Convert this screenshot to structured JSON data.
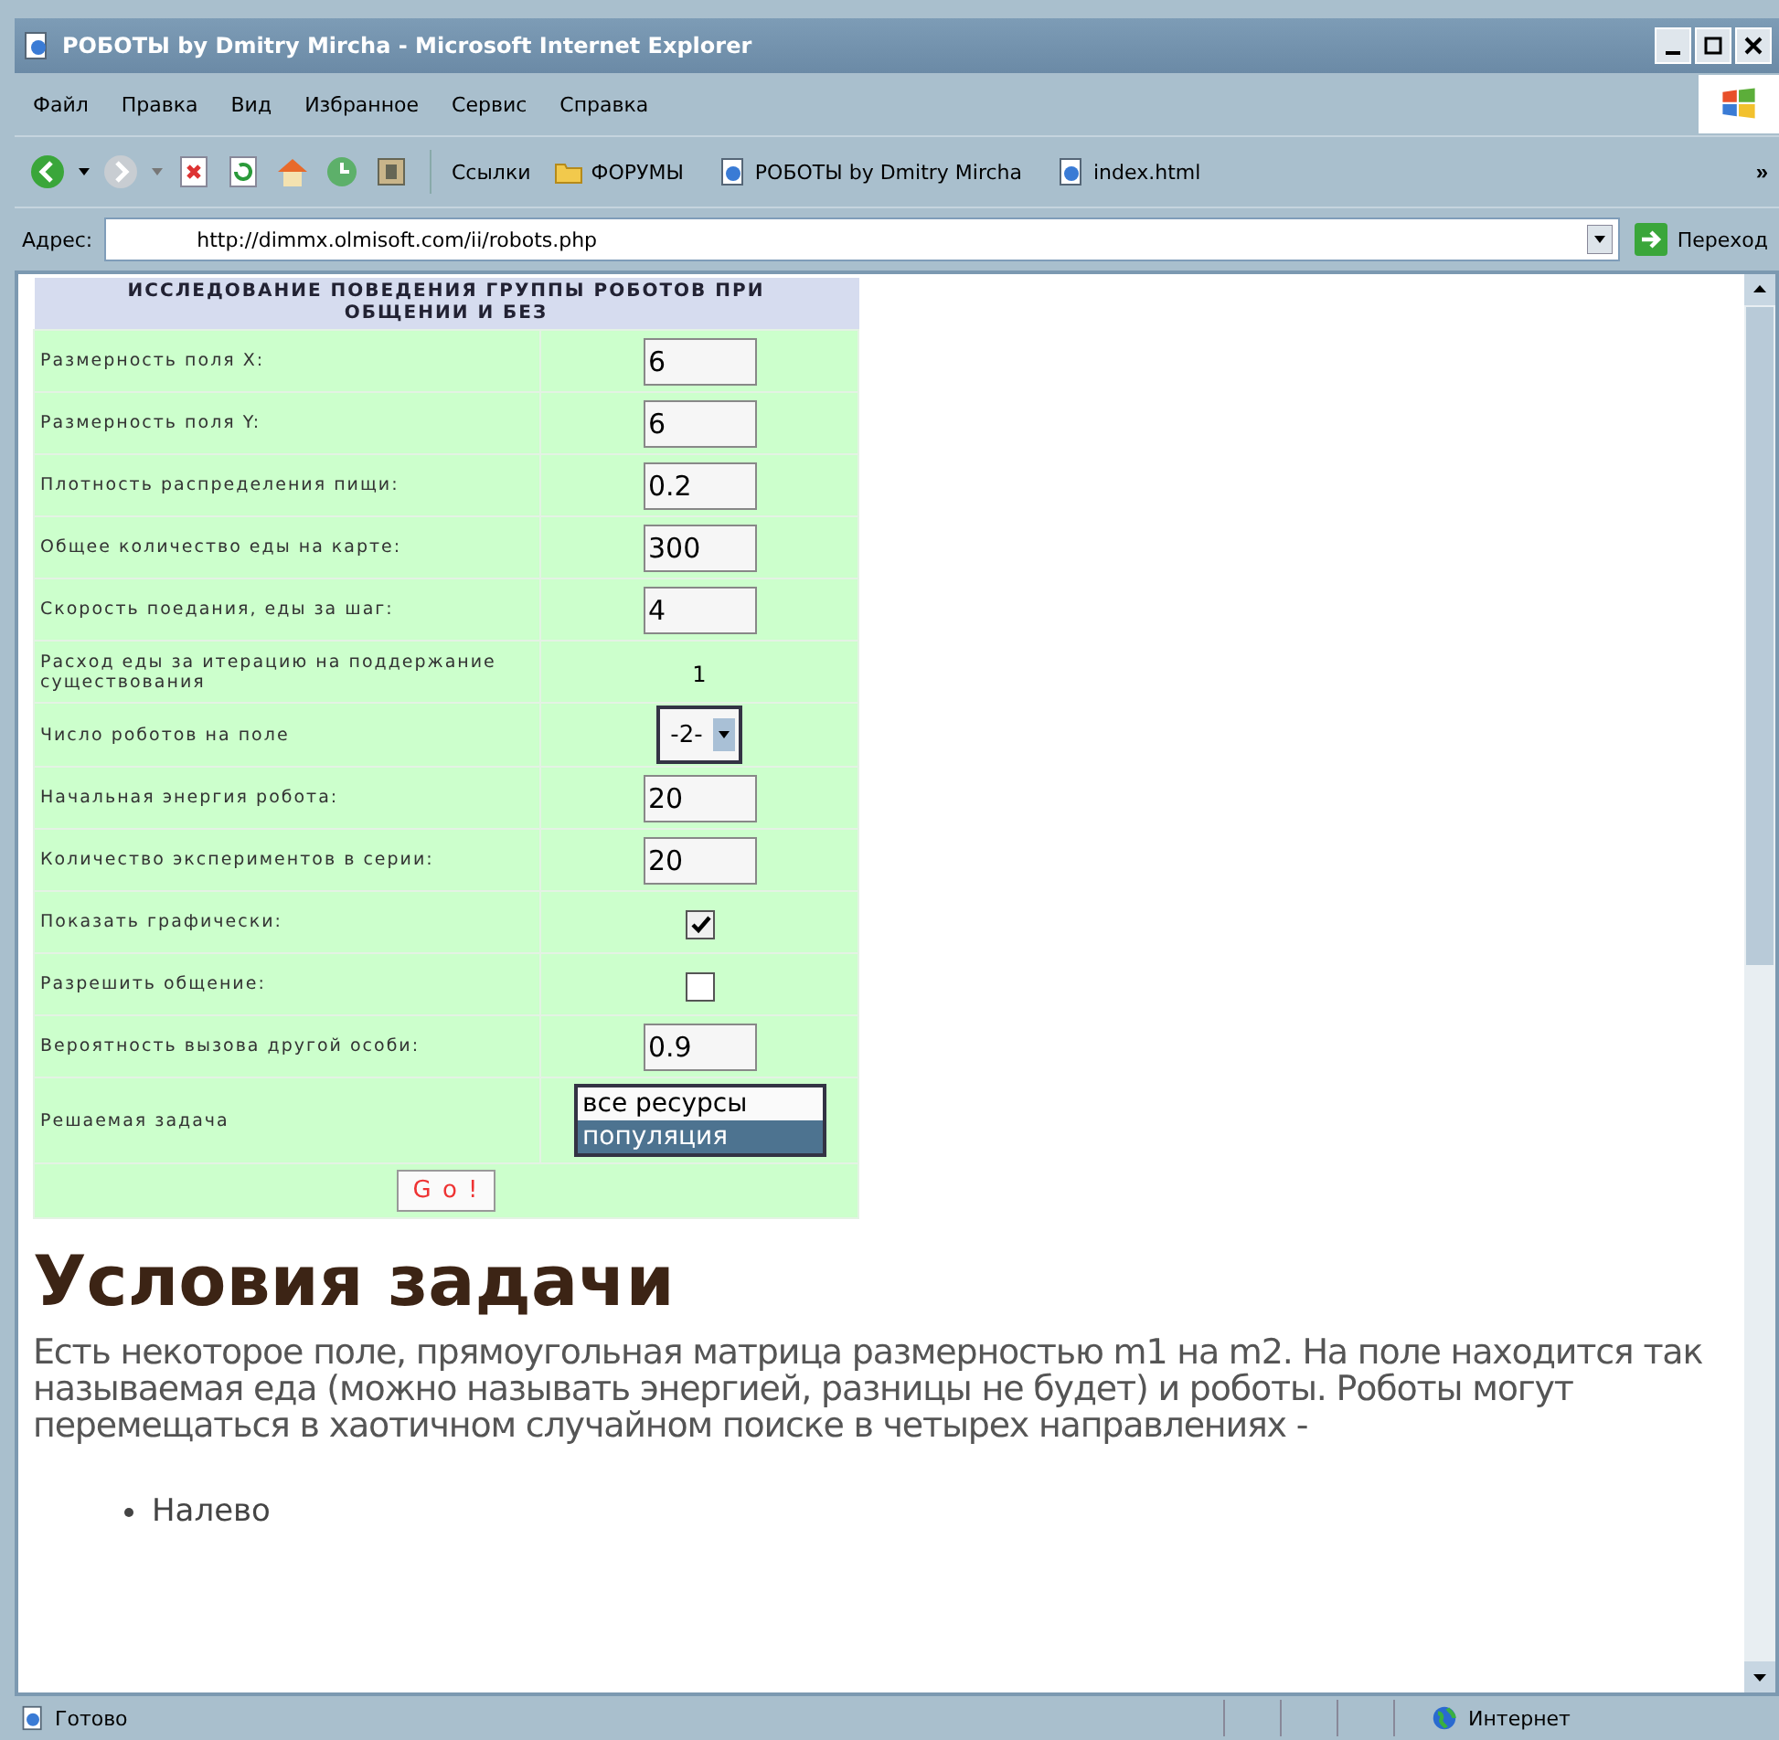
{
  "window": {
    "title": "РОБОТЫ by Dmitry Mircha - Microsoft Internet Explorer"
  },
  "menu": [
    "Файл",
    "Правка",
    "Вид",
    "Избранное",
    "Сервис",
    "Справка"
  ],
  "links": {
    "label": "Ссылки",
    "items": [
      {
        "kind": "folder",
        "label": "ФОРУМЫ"
      },
      {
        "kind": "page",
        "label": "РОБОТЫ by Dmitry Mircha"
      },
      {
        "kind": "page",
        "label": "index.html"
      }
    ],
    "more": "»"
  },
  "address": {
    "label": "Адрес:",
    "value": "http://dimmx.olmisoft.com/ii/robots.php",
    "go": "Переход"
  },
  "form": {
    "title": "ИССЛЕДОВАНИЕ ПОВЕДЕНИЯ ГРУППЫ РОБОТОВ ПРИ ОБЩЕНИИ И БЕЗ",
    "rows": [
      {
        "kind": "input",
        "label": "Размерность поля X:",
        "value": "6"
      },
      {
        "kind": "input",
        "label": "Размерность поля Y:",
        "value": "6"
      },
      {
        "kind": "input",
        "label": "Плотность распределения пищи:",
        "value": "0.2"
      },
      {
        "kind": "input",
        "label": "Общее количество еды на карте:",
        "value": "300"
      },
      {
        "kind": "input",
        "label": "Скорость поедания, еды за шаг:",
        "value": "4"
      },
      {
        "kind": "static",
        "label": "Расход еды за итерацию на поддержание существования",
        "value": "1"
      },
      {
        "kind": "select",
        "label": "Число роботов на поле",
        "value": "-2-"
      },
      {
        "kind": "input",
        "label": "Начальная энергия робота:",
        "value": "20"
      },
      {
        "kind": "input",
        "label": "Количество экспериментов в серии:",
        "value": "20"
      },
      {
        "kind": "checkbox",
        "label": "Показать графически:",
        "checked": true
      },
      {
        "kind": "checkbox",
        "label": "Разрешить общение:",
        "checked": false
      },
      {
        "kind": "input",
        "label": "Вероятность вызова другой особи:",
        "value": "0.9"
      },
      {
        "kind": "listbox",
        "label": "Решаемая задача",
        "options": [
          {
            "label": "все ресурсы",
            "selected": false
          },
          {
            "label": "популяция",
            "selected": true
          }
        ]
      }
    ],
    "submit": "G o !"
  },
  "heading": "Условия задачи",
  "paragraph": "Есть некоторое поле, прямоугольная матрица размерностью m1 на m2. На поле находится так называемая еда (можно называть энергией, разницы не будет) и роботы. Роботы могут перемещаться в хаотичном случайном поиске в четырех направлениях -",
  "list": [
    "Налево"
  ],
  "status_bar": {
    "text": "Готово",
    "zone": "Интернет"
  }
}
